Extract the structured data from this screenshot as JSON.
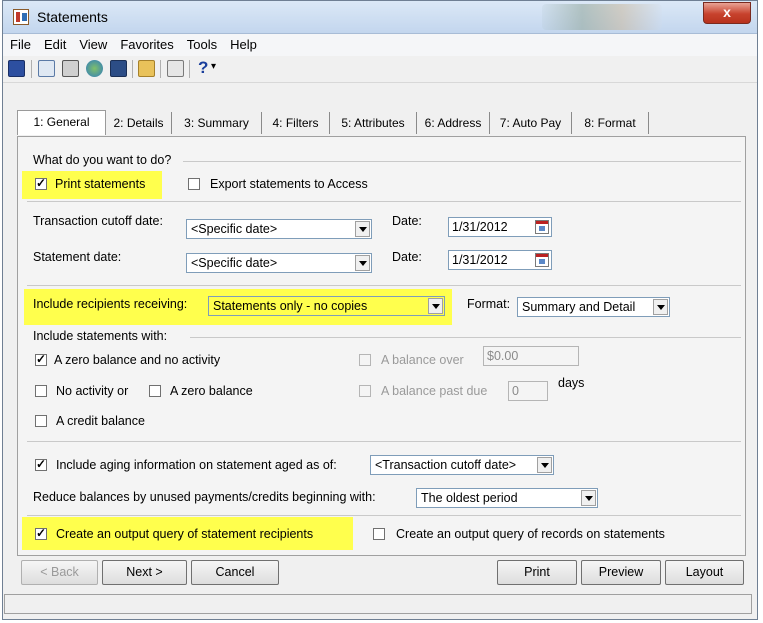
{
  "window": {
    "title": "Statements",
    "close_symbol": "x"
  },
  "menu": [
    "File",
    "Edit",
    "View",
    "Favorites",
    "Tools",
    "Help"
  ],
  "toolbar": {
    "icons": [
      "save-icon",
      "print-preview-icon",
      "print-icon",
      "globe-icon",
      "screen-icon",
      "folder-icon",
      "properties-icon"
    ],
    "help_symbol": "?",
    "help_dropdown": "▾"
  },
  "tabs": [
    "1: General",
    "2: Details",
    "3: Summary",
    "4: Filters",
    "5: Attributes",
    "6: Address",
    "7: Auto Pay",
    "8: Format"
  ],
  "general": {
    "section_title": "What do you want to do?",
    "print_statements": "Print statements",
    "export_access": "Export statements to Access",
    "transaction_cutoff_label": "Transaction cutoff date:",
    "transaction_cutoff_value": "<Specific date>",
    "date_label": "Date:",
    "transaction_cutoff_date": "1/31/2012",
    "statement_date_label": "Statement date:",
    "statement_date_value": "<Specific date>",
    "statement_date": "1/31/2012",
    "include_recipients_label": "Include recipients receiving:",
    "include_recipients_value": "Statements only - no copies",
    "format_label": "Format:",
    "format_value": "Summary and Detail",
    "include_statements_label": "Include statements with:",
    "zero_balance_no_activity": "A zero balance and no activity",
    "no_activity_or": "No activity or",
    "a_zero_balance": "A zero balance",
    "credit_balance": "A credit balance",
    "balance_over": "A balance over",
    "balance_over_value": "$0.00",
    "balance_past_due": "A balance past due",
    "past_due_value": "0",
    "days": "days",
    "include_aging": "Include aging information on statement aged as of:",
    "aging_value": "<Transaction cutoff date>",
    "reduce_balances": "Reduce balances by unused payments/credits beginning with:",
    "reduce_value": "The oldest period",
    "output_query_recipients": "Create an output query of statement recipients",
    "output_query_records": "Create an output query of records on statements"
  },
  "buttons": {
    "back": "< Back",
    "next": "Next >",
    "cancel": "Cancel",
    "print": "Print",
    "preview": "Preview",
    "layout": "Layout"
  }
}
